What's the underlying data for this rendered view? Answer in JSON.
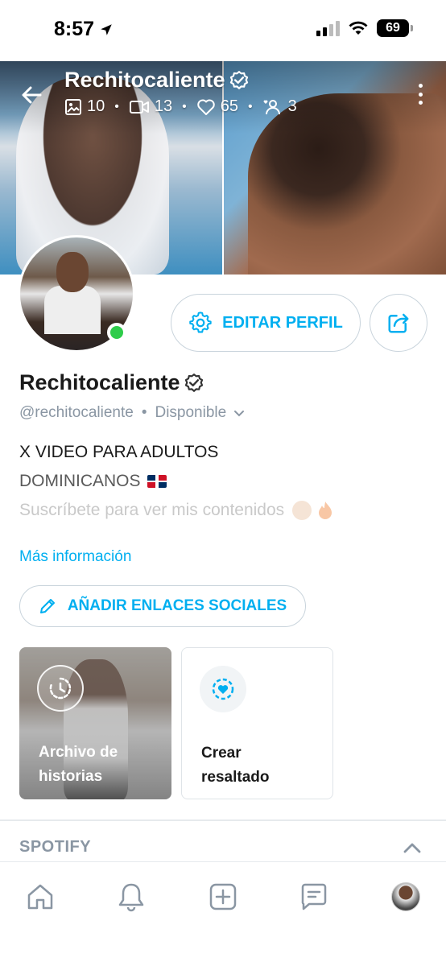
{
  "status_bar": {
    "time": "8:57",
    "battery": "69"
  },
  "header": {
    "title": "Rechitocaliente",
    "stats": {
      "photos": "10",
      "videos": "13",
      "likes": "65",
      "fans": "3"
    }
  },
  "actions": {
    "edit_profile_label": "EDITAR PERFIL"
  },
  "profile": {
    "name": "Rechitocaliente",
    "handle": "@rechitocaliente",
    "separator": "•",
    "status": "Disponible",
    "bio_line1": "X VIDEO PARA ADULTOS",
    "bio_line2": "DOMINICANOS",
    "bio_line3": "Suscríbete para ver mis contenidos",
    "bio_line2_emoji": "🇩🇴",
    "bio_line3_emoji": "🙈🔥",
    "more_info": "Más información"
  },
  "social": {
    "add_links_label": "AÑADIR ENLACES SOCIALES"
  },
  "highlights": [
    {
      "line1": "Archivo de",
      "line2": "historias"
    },
    {
      "line1": "Crear",
      "line2": "resaltado"
    }
  ],
  "spotify": {
    "title": "SPOTIFY"
  },
  "colors": {
    "accent": "#00aff0",
    "muted": "#8a96a3",
    "online": "#2ecc4a",
    "border": "#c9d4dc"
  },
  "icons": {
    "tabs": [
      "home-icon",
      "bell-icon",
      "plus-square-icon",
      "message-icon",
      "profile-avatar"
    ]
  }
}
